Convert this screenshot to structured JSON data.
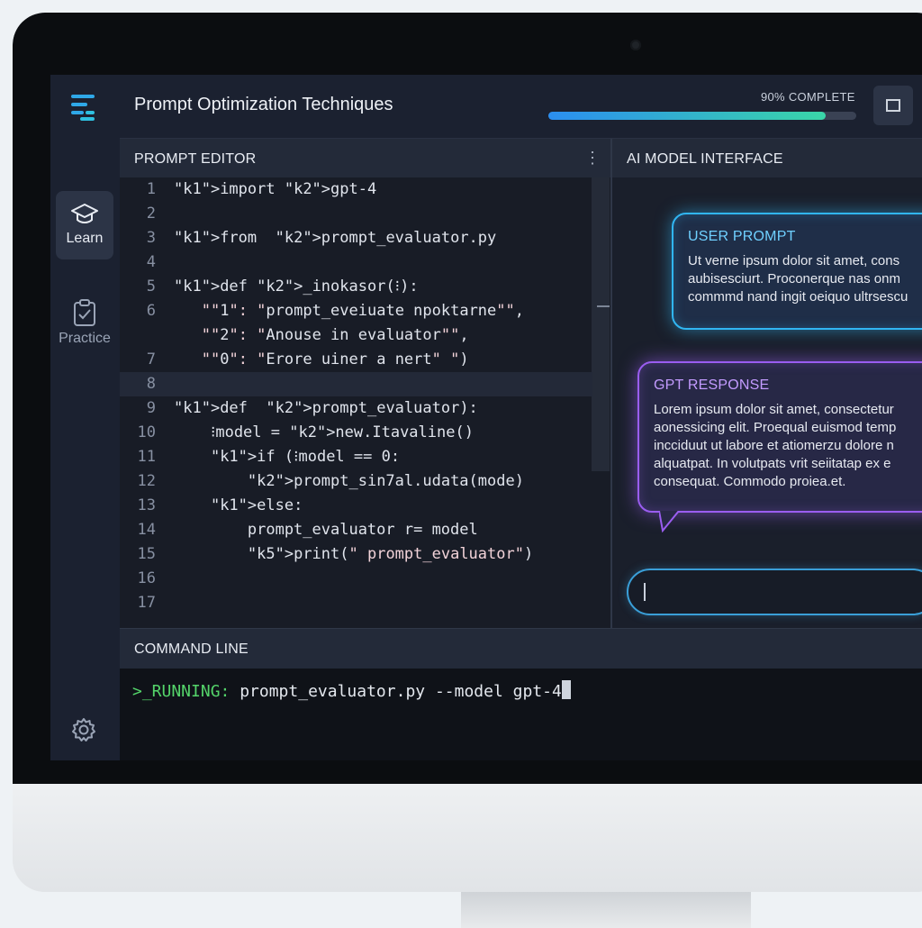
{
  "header": {
    "title": "Prompt Optimization Techniques",
    "progress_label": "90% COMPLETE",
    "progress": 0.9
  },
  "sidebar": {
    "items": [
      {
        "label": "Learn",
        "icon": "graduation-cap-icon",
        "active": true
      },
      {
        "label": "Practice",
        "icon": "clipboard-check-icon",
        "active": false
      }
    ],
    "settings_icon": "gear-icon"
  },
  "editor": {
    "title": "PROMPT EDITOR",
    "lines": [
      {
        "num": "1",
        "code": "import gpt-4"
      },
      {
        "num": "2",
        "code": ""
      },
      {
        "num": "3",
        "code": "from  prompt_evaluator.py"
      },
      {
        "num": "4",
        "code": ""
      },
      {
        "num": "5",
        "code": "def _inokasor(⁝):"
      },
      {
        "num": "6",
        "code": "   \"\"1\": \"prompt_eveiuate npoktarne\"\","
      },
      {
        "num": "",
        "code": "   \"\"2\": \"Anouse in evaluator\"\","
      },
      {
        "num": "7",
        "code": "   \"\"0\": \"Erore uiner a nert\" \")"
      },
      {
        "num": "8",
        "code": ""
      },
      {
        "num": "9",
        "code": "def  prompt_evaluator):"
      },
      {
        "num": "10",
        "code": "    ⁝model = new.Itavaline()"
      },
      {
        "num": "11",
        "code": "    if (⁝model == 0:"
      },
      {
        "num": "12",
        "code": "        prompt_sin7al.udata(mode)"
      },
      {
        "num": "13",
        "code": "    else:"
      },
      {
        "num": "14",
        "code": "        prompt_evaluator r= model"
      },
      {
        "num": "15",
        "code": "        print(\" prompt_evaluator\")"
      },
      {
        "num": "16",
        "code": ""
      },
      {
        "num": "17",
        "code": ""
      }
    ]
  },
  "ai": {
    "title": "AI MODEL INTERFACE",
    "user_prompt_title": "USER PROMPT",
    "user_prompt_text": "Ut verne ipsum dolor sit amet, cons\naubisesciurt. Proconerque nas onm\ncommmd nand ingit oeiquo ultrsescu",
    "response_title": "GPT RESPONSE",
    "response_text": "Lorem ipsum dolor sit amet, consectetur\naonessicing elit. Proequal euismod temp\nincciduut ut labore et atiomerzu dolore n\nalquatpat. In volutpats vrit seiitatap ex e\nconsequat. Commodo proiea.et.",
    "input_value": "",
    "colors": {
      "user": "#31b6f2",
      "gpt": "#9a5df0"
    }
  },
  "command": {
    "title": "COMMAND LINE",
    "prompt": ">_RUNNING:",
    "text": " prompt_evaluator.py --model gpt-4"
  }
}
